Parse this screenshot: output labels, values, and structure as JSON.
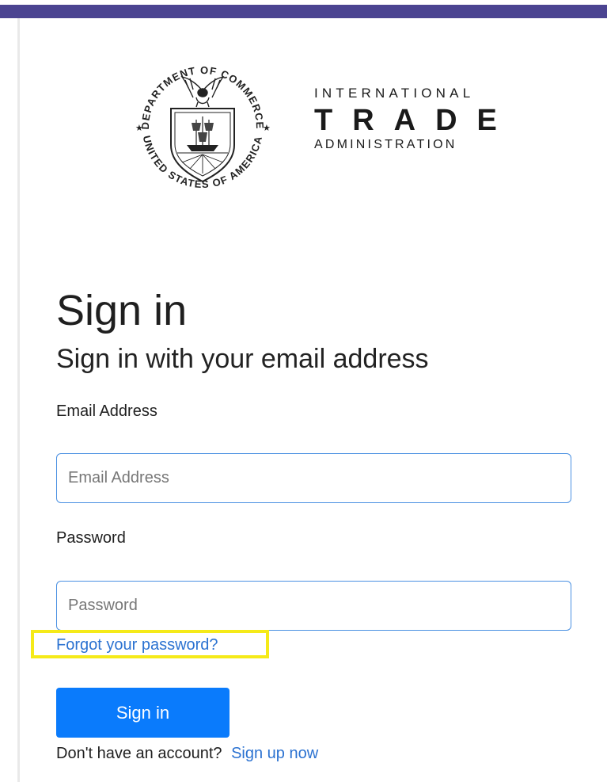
{
  "branding": {
    "seal": {
      "top_text": "DEPARTMENT OF COMMERCE",
      "bottom_text": "UNITED STATES OF AMERICA"
    },
    "logo": {
      "line1": "INTERNATIONAL",
      "line2": "TRADE",
      "line3": "ADMINISTRATION"
    }
  },
  "form": {
    "title": "Sign in",
    "subtitle": "Sign in with your email address",
    "email": {
      "label": "Email Address",
      "placeholder": "Email Address",
      "value": ""
    },
    "password": {
      "label": "Password",
      "placeholder": "Password",
      "value": ""
    },
    "forgot_password_label": "Forgot your password?",
    "submit_label": "Sign in",
    "signup_prompt": "Don't have an account?",
    "signup_label": "Sign up now"
  },
  "colors": {
    "top_bar": "#4b4491",
    "primary_button": "#0a7bfc",
    "link": "#2b72d1",
    "input_border": "#4a90e2",
    "highlight": "#f5ea18"
  }
}
